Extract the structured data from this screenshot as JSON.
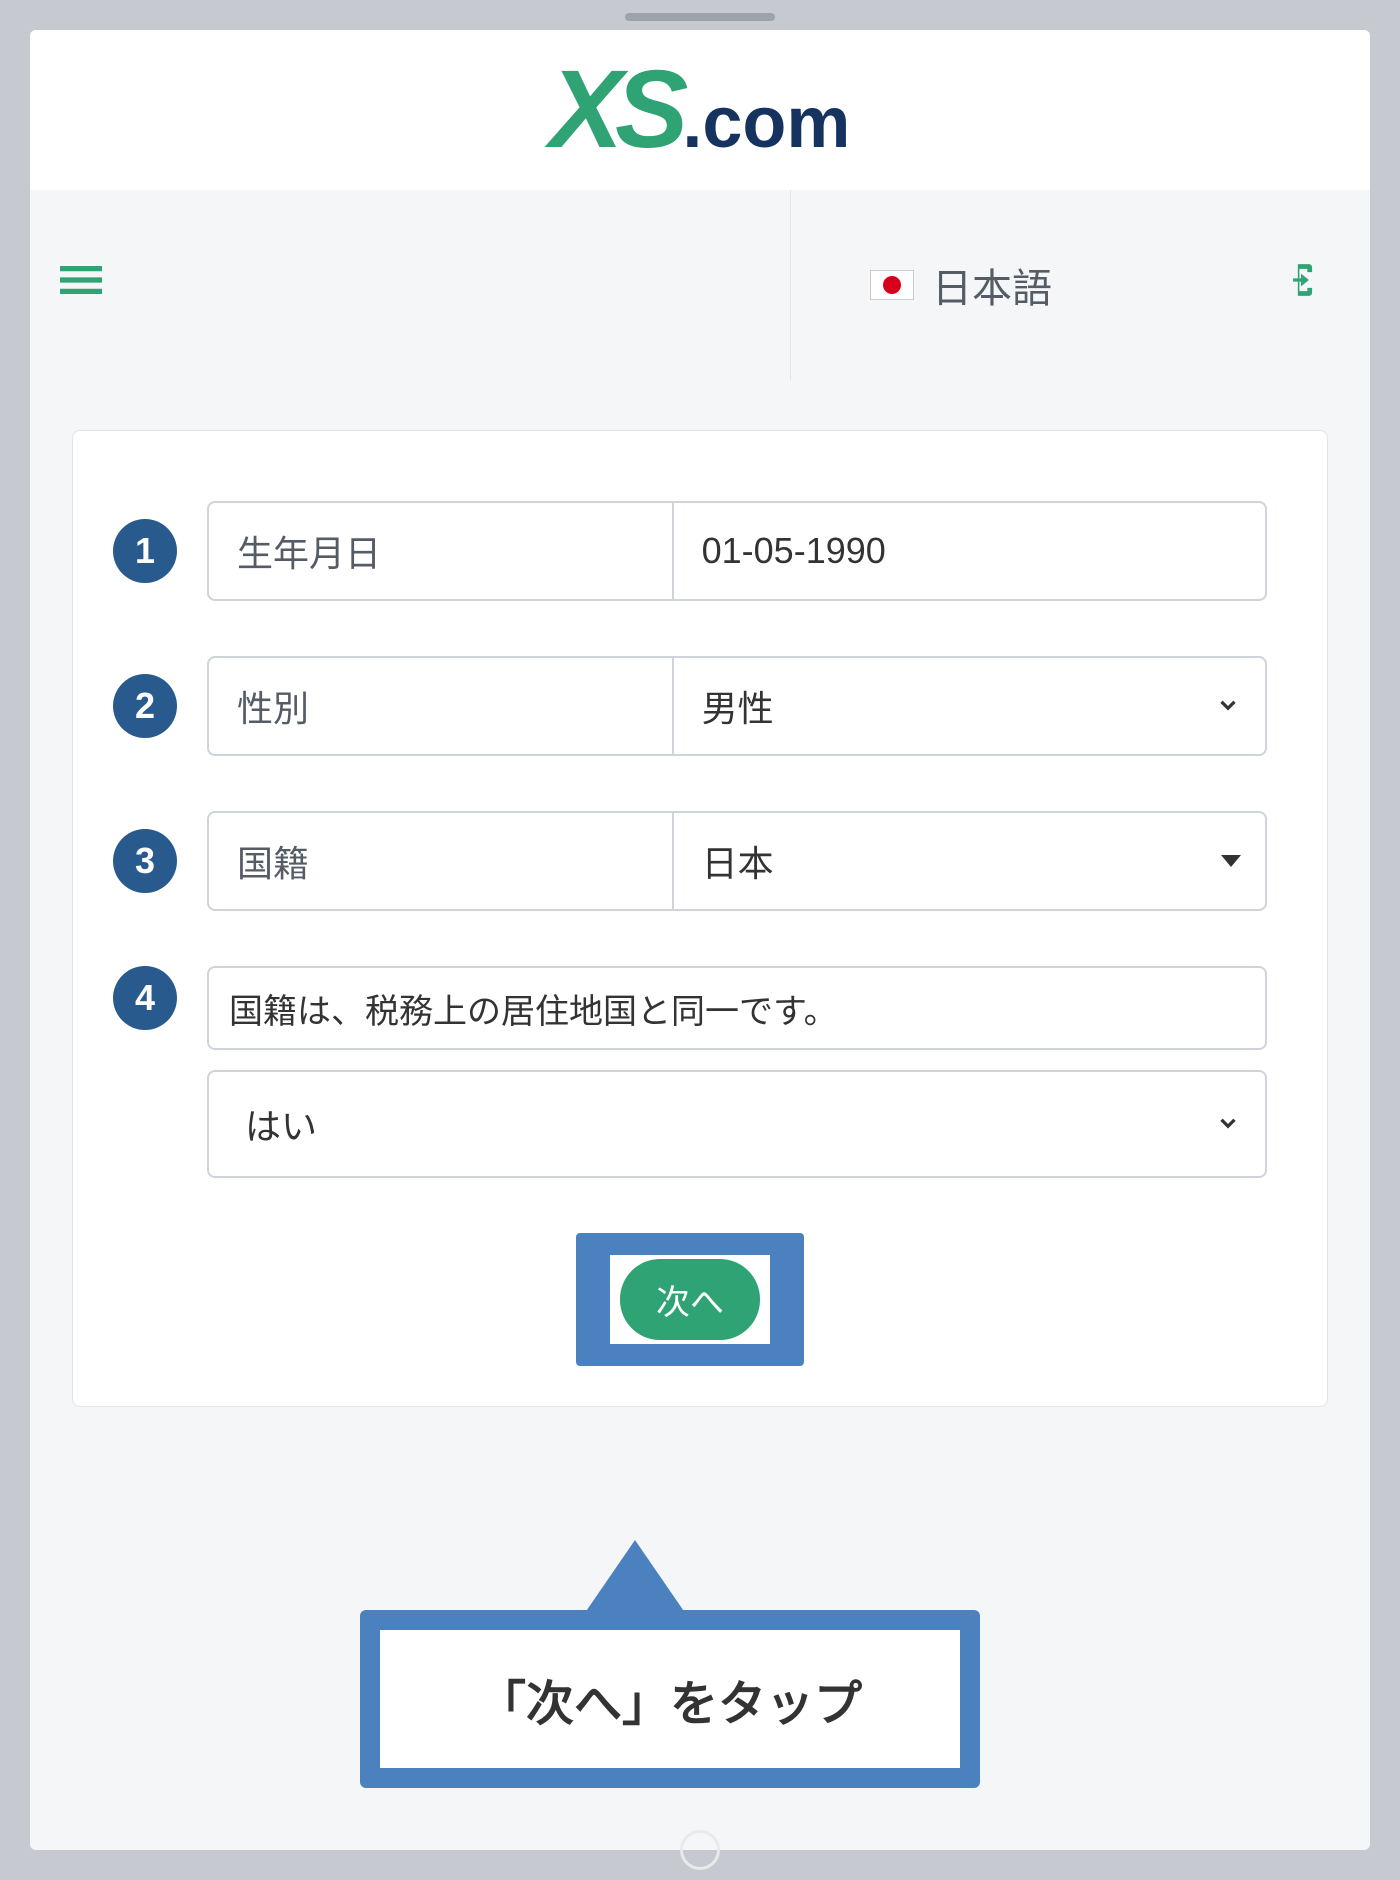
{
  "logo": {
    "xs": "XS",
    "dotcom": ".com"
  },
  "nav": {
    "language": "日本語"
  },
  "form": {
    "rows": [
      {
        "num": "1",
        "label": "生年月日",
        "value": "01-05-1990",
        "type": "date"
      },
      {
        "num": "2",
        "label": "性別",
        "value": "男性",
        "type": "chevron"
      },
      {
        "num": "3",
        "label": "国籍",
        "value": "日本",
        "type": "caret"
      }
    ],
    "statement": {
      "num": "4",
      "text": "国籍は、税務上の居住地国と同一です。",
      "answer": "はい"
    },
    "next_label": "次へ"
  },
  "callout": {
    "text": "「次へ」をタップ"
  }
}
